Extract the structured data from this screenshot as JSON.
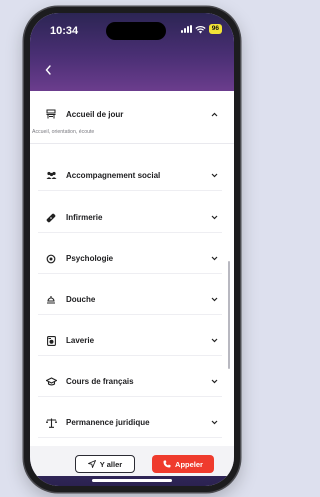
{
  "status_bar": {
    "time": "10:34",
    "battery": "96"
  },
  "header": {
    "back_icon": "chevron-left-icon"
  },
  "services": [
    {
      "label": "Accueil de jour",
      "icon": "desk-icon",
      "expanded": true,
      "description": "Accueil, orientation, écoute"
    },
    {
      "label": "Accompagnement social",
      "icon": "people-icon",
      "expanded": false
    },
    {
      "label": "Infirmerie",
      "icon": "bandage-icon",
      "expanded": false
    },
    {
      "label": "Psychologie",
      "icon": "brain-icon",
      "expanded": false
    },
    {
      "label": "Douche",
      "icon": "shower-icon",
      "expanded": false
    },
    {
      "label": "Laverie",
      "icon": "washing-machine-icon",
      "expanded": false
    },
    {
      "label": "Cours de français",
      "icon": "graduation-cap-icon",
      "expanded": false
    },
    {
      "label": "Permanence juridique",
      "icon": "scales-icon",
      "expanded": false
    }
  ],
  "actions": {
    "go_label": "Y aller",
    "call_label": "Appeler",
    "call_color": "#ef3b2d"
  },
  "colors": {
    "header_gradient": [
      "#2c2554",
      "#6b3d8d"
    ],
    "page_background": "#dde0ee"
  }
}
